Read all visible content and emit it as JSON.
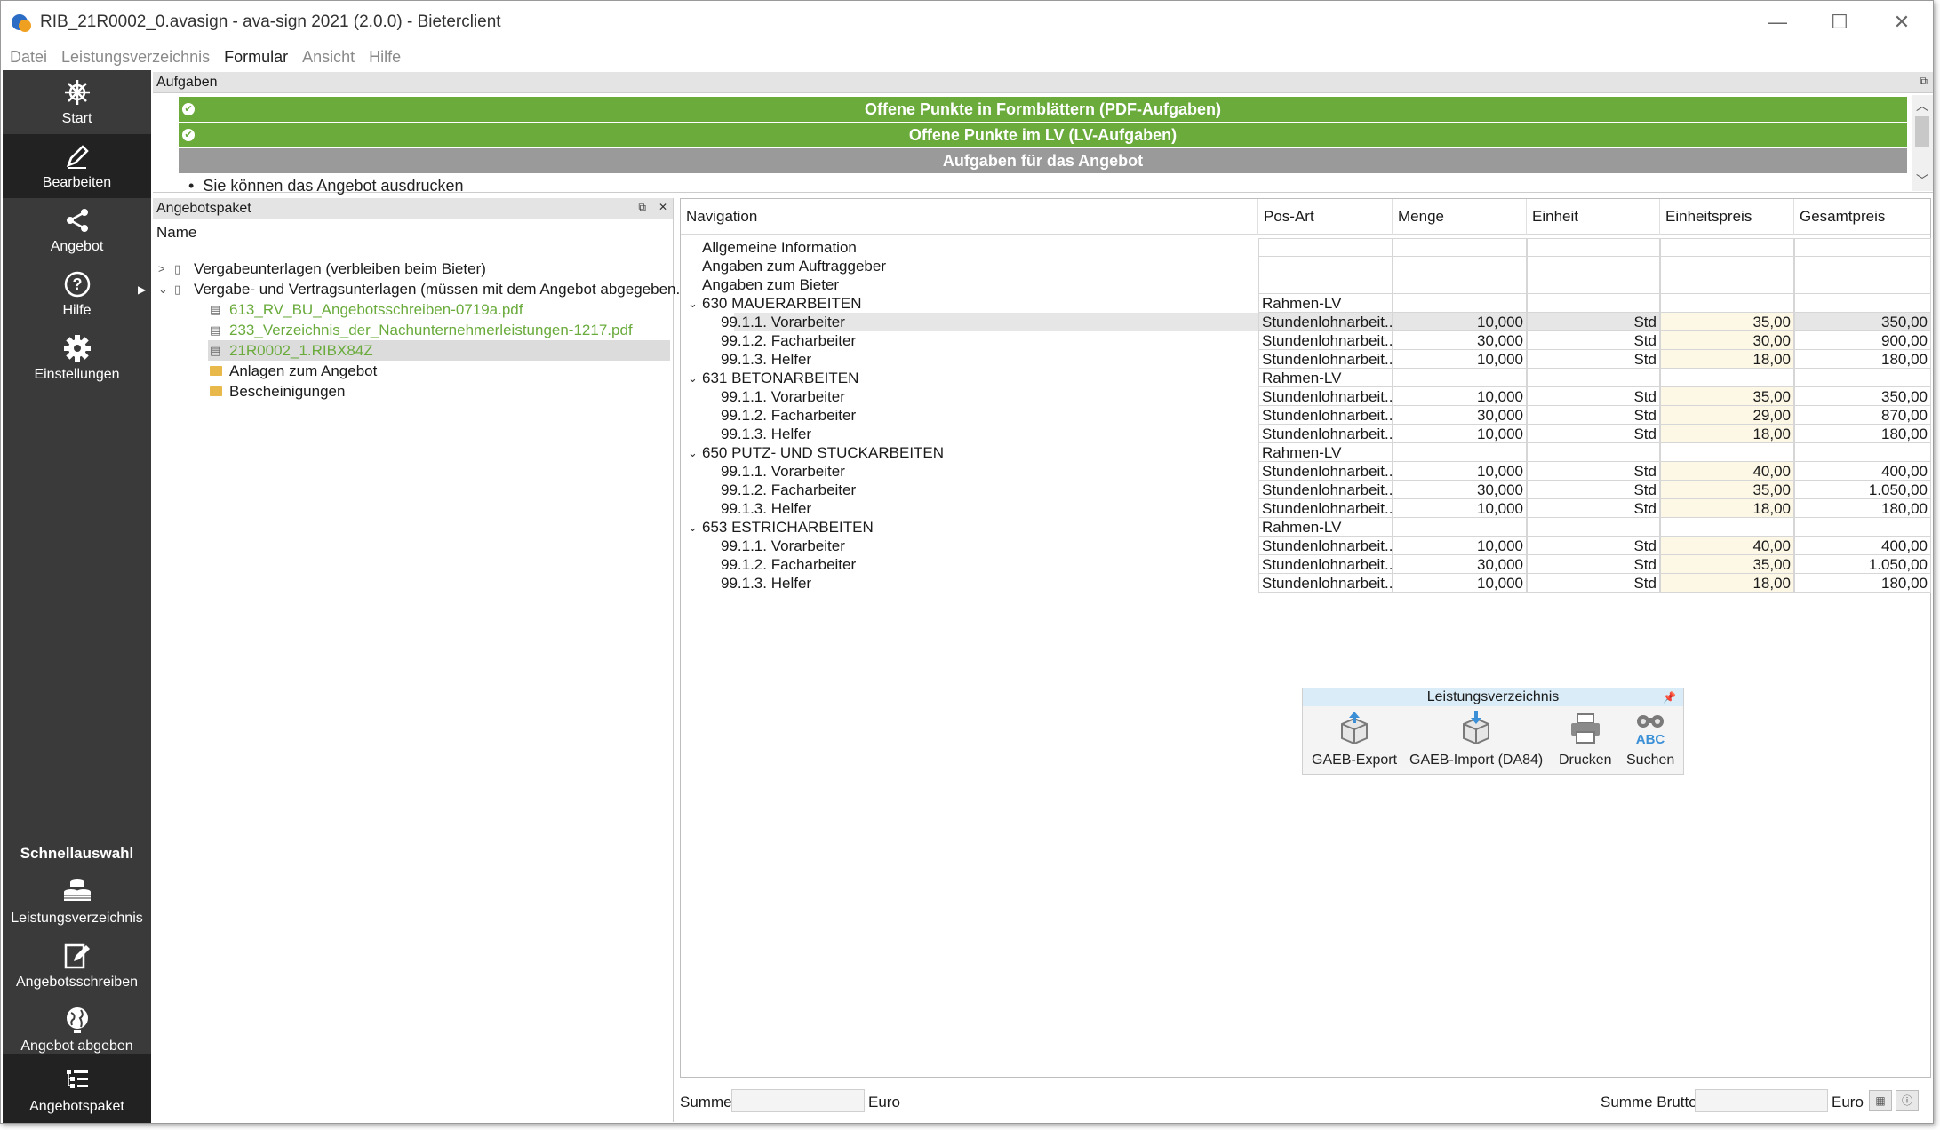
{
  "window": {
    "title": "RIB_21R0002_0.avasign - ava-sign 2021 (2.0.0) - Bieterclient",
    "minimize": "—",
    "maximize": "☐",
    "close": "✕"
  },
  "menu": [
    "Datei",
    "Leistungsverzeichnis",
    "Formular",
    "Ansicht",
    "Hilfe"
  ],
  "sidebar": {
    "items": [
      {
        "label": "Start",
        "icon": "helm-icon"
      },
      {
        "label": "Bearbeiten",
        "icon": "pencil-icon"
      },
      {
        "label": "Angebot",
        "icon": "share-icon"
      },
      {
        "label": "Hilfe",
        "icon": "help-icon"
      },
      {
        "label": "Einstellungen",
        "icon": "gear-icon"
      }
    ],
    "quick_title": "Schnellauswahl",
    "quick_items": [
      {
        "label": "Leistungsverzeichnis",
        "icon": "coins-icon"
      },
      {
        "label": "Angebotsschreiben",
        "icon": "edit-doc-icon"
      },
      {
        "label": "Angebot abgeben",
        "icon": "globe-icon"
      },
      {
        "label": "Angebotspaket",
        "icon": "tree-list-icon"
      }
    ]
  },
  "aufgaben": {
    "title": "Aufgaben",
    "rows": [
      "Offene Punkte in Formblättern (PDF-Aufgaben)",
      "Offene Punkte im LV (LV-Aufgaben)",
      "Aufgaben für das Angebot"
    ],
    "sub_item": "Sie können das Angebot ausdrucken"
  },
  "paket": {
    "title": "Angebotspaket",
    "column": "Name",
    "tree": [
      "Vergabeunterlagen (verbleiben beim Bieter)",
      "Vergabe- und Vertragsunterlagen (müssen mit dem Angebot abgegeben...",
      "613_RV_BU_Angebotsschreiben-0719a.pdf",
      "233_Verzeichnis_der_Nachunternehmerleistungen-1217.pdf",
      "21R0002_1.RIBX84Z",
      "Anlagen zum Angebot",
      "Bescheinigungen"
    ]
  },
  "nav": {
    "headers": [
      "Navigation",
      "Pos-Art",
      "Menge",
      "Einheit",
      "Einheitspreis",
      "Gesamtpreis"
    ],
    "info_rows": [
      "Allgemeine Information",
      "Angaben zum Auftraggeber",
      "Angaben zum Bieter"
    ],
    "groups": [
      {
        "title": "630 MAUERARBEITEN",
        "pos_art": "Rahmen-LV",
        "items": [
          {
            "name": "99.1.1. Vorarbeiter",
            "pos_art": "Stundenlohnarbeit...",
            "menge": "10,000",
            "einheit": "Std",
            "ep": "35,00",
            "gp": "350,00"
          },
          {
            "name": "99.1.2. Facharbeiter",
            "pos_art": "Stundenlohnarbeit...",
            "menge": "30,000",
            "einheit": "Std",
            "ep": "30,00",
            "gp": "900,00"
          },
          {
            "name": "99.1.3. Helfer",
            "pos_art": "Stundenlohnarbeit...",
            "menge": "10,000",
            "einheit": "Std",
            "ep": "18,00",
            "gp": "180,00"
          }
        ]
      },
      {
        "title": "631 BETONARBEITEN",
        "pos_art": "Rahmen-LV",
        "items": [
          {
            "name": "99.1.1. Vorarbeiter",
            "pos_art": "Stundenlohnarbeit...",
            "menge": "10,000",
            "einheit": "Std",
            "ep": "35,00",
            "gp": "350,00"
          },
          {
            "name": "99.1.2. Facharbeiter",
            "pos_art": "Stundenlohnarbeit...",
            "menge": "30,000",
            "einheit": "Std",
            "ep": "29,00",
            "gp": "870,00"
          },
          {
            "name": "99.1.3. Helfer",
            "pos_art": "Stundenlohnarbeit...",
            "menge": "10,000",
            "einheit": "Std",
            "ep": "18,00",
            "gp": "180,00"
          }
        ]
      },
      {
        "title": "650 PUTZ- UND STUCKARBEITEN",
        "pos_art": "Rahmen-LV",
        "items": [
          {
            "name": "99.1.1. Vorarbeiter",
            "pos_art": "Stundenlohnarbeit...",
            "menge": "10,000",
            "einheit": "Std",
            "ep": "40,00",
            "gp": "400,00"
          },
          {
            "name": "99.1.2. Facharbeiter",
            "pos_art": "Stundenlohnarbeit...",
            "menge": "30,000",
            "einheit": "Std",
            "ep": "35,00",
            "gp": "1.050,00"
          },
          {
            "name": "99.1.3. Helfer",
            "pos_art": "Stundenlohnarbeit...",
            "menge": "10,000",
            "einheit": "Std",
            "ep": "18,00",
            "gp": "180,00"
          }
        ]
      },
      {
        "title": "653 ESTRICHARBEITEN",
        "pos_art": "Rahmen-LV",
        "items": [
          {
            "name": "99.1.1. Vorarbeiter",
            "pos_art": "Stundenlohnarbeit...",
            "menge": "10,000",
            "einheit": "Std",
            "ep": "40,00",
            "gp": "400,00"
          },
          {
            "name": "99.1.2. Facharbeiter",
            "pos_art": "Stundenlohnarbeit...",
            "menge": "30,000",
            "einheit": "Std",
            "ep": "35,00",
            "gp": "1.050,00"
          },
          {
            "name": "99.1.3. Helfer",
            "pos_art": "Stundenlohnarbeit...",
            "menge": "10,000",
            "einheit": "Std",
            "ep": "18,00",
            "gp": "180,00"
          }
        ]
      }
    ]
  },
  "toolbox": {
    "title": "Leistungsverzeichnis",
    "buttons": [
      "GAEB-Export",
      "GAEB-Import (DA84)",
      "Drucken",
      "Suchen"
    ],
    "abc": "ABC"
  },
  "status": {
    "summe_label": "Summe",
    "summe_unit": "Euro",
    "brutto_label": "Summe Brutto",
    "brutto_unit": "Euro"
  },
  "colors": {
    "green": "#6aab3c",
    "sidebar": "#3a3a3a",
    "sidebar_active": "#222222",
    "price_cell": "#fdf8e6"
  }
}
